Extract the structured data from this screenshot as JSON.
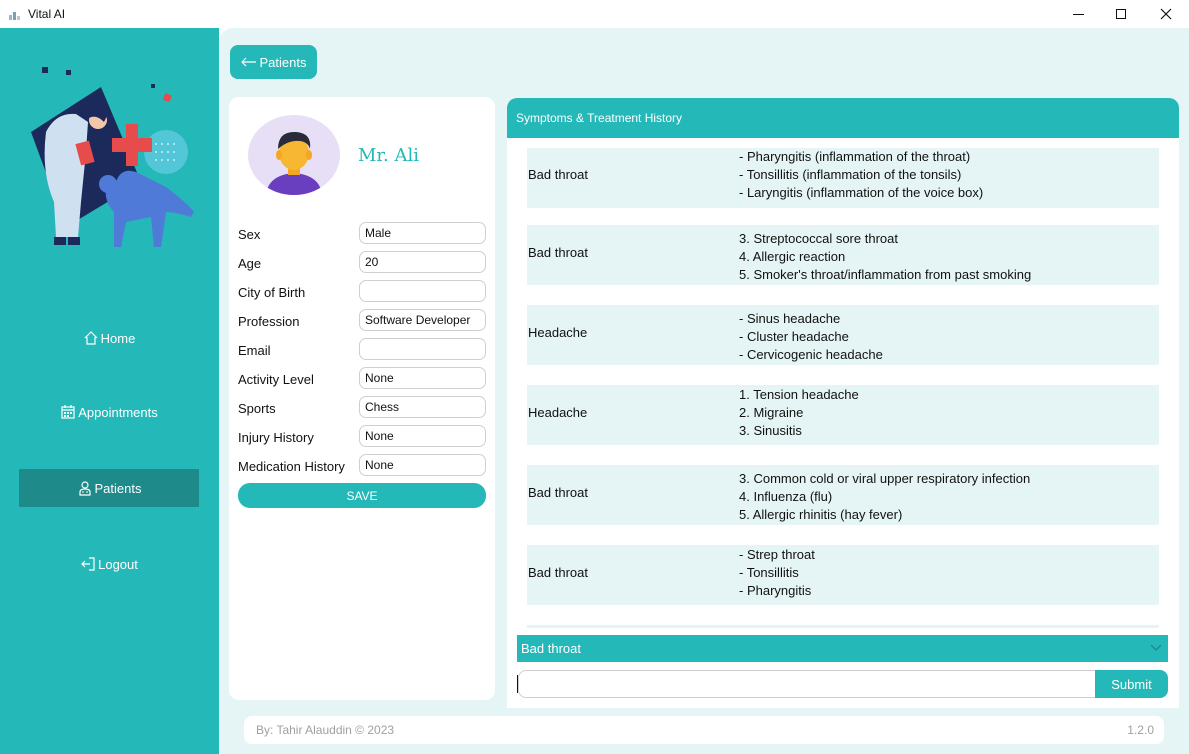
{
  "window": {
    "title": "Vital AI"
  },
  "sidebar": {
    "items": [
      {
        "label": "Home",
        "icon": "home-icon"
      },
      {
        "label": "Appointments",
        "icon": "calendar-icon"
      },
      {
        "label": "Patients",
        "icon": "patient-icon",
        "active": true
      },
      {
        "label": "Logout",
        "icon": "logout-icon"
      }
    ]
  },
  "main": {
    "back_label": "Patients"
  },
  "patient": {
    "name": "Mr. Ali",
    "fields": [
      {
        "label": "Sex",
        "value": "Male"
      },
      {
        "label": "Age",
        "value": "20"
      },
      {
        "label": "City of Birth",
        "value": ""
      },
      {
        "label": "Profession",
        "value": "Software Developer"
      },
      {
        "label": "Email",
        "value": ""
      },
      {
        "label": "Activity Level",
        "value": "None"
      },
      {
        "label": "Sports",
        "value": "Chess"
      },
      {
        "label": "Injury History",
        "value": "None"
      },
      {
        "label": "Medication History",
        "value": "None"
      }
    ],
    "save_label": "SAVE"
  },
  "history": {
    "title": "Symptoms & Treatment History",
    "rows": [
      {
        "symptom": "Bad throat",
        "treatment": [
          "- Pharyngitis (inflammation of the throat)",
          "- Tonsillitis (inflammation of the tonsils)",
          "- Laryngitis (inflammation of the voice box)"
        ]
      },
      {
        "symptom": "Bad throat",
        "treatment": [
          "3. Streptococcal sore throat",
          "4. Allergic reaction",
          "5. Smoker's throat/inflammation from past smoking"
        ]
      },
      {
        "symptom": "Headache",
        "treatment": [
          "- Sinus headache",
          "- Cluster headache",
          "- Cervicogenic headache"
        ]
      },
      {
        "symptom": "Headache",
        "treatment": [
          "1. Tension headache",
          "2. Migraine",
          "3. Sinusitis"
        ]
      },
      {
        "symptom": "Bad throat",
        "treatment": [
          "3. Common cold or viral upper respiratory infection",
          "4. Influenza (flu)",
          "5. Allergic rhinitis (hay fever)"
        ]
      },
      {
        "symptom": "Bad throat",
        "treatment": [
          "- Strep throat",
          "- Tonsillitis",
          "- Pharyngitis"
        ]
      }
    ],
    "selected_symptom": "Bad throat",
    "query_value": "",
    "submit_label": "Submit"
  },
  "footer": {
    "credit": "By: Tahir Alauddin © 2023",
    "version": "1.2.0"
  },
  "colors": {
    "accent": "#24b8b8",
    "accent_dark": "#1f8a8a",
    "background": "#e5f5f5"
  }
}
